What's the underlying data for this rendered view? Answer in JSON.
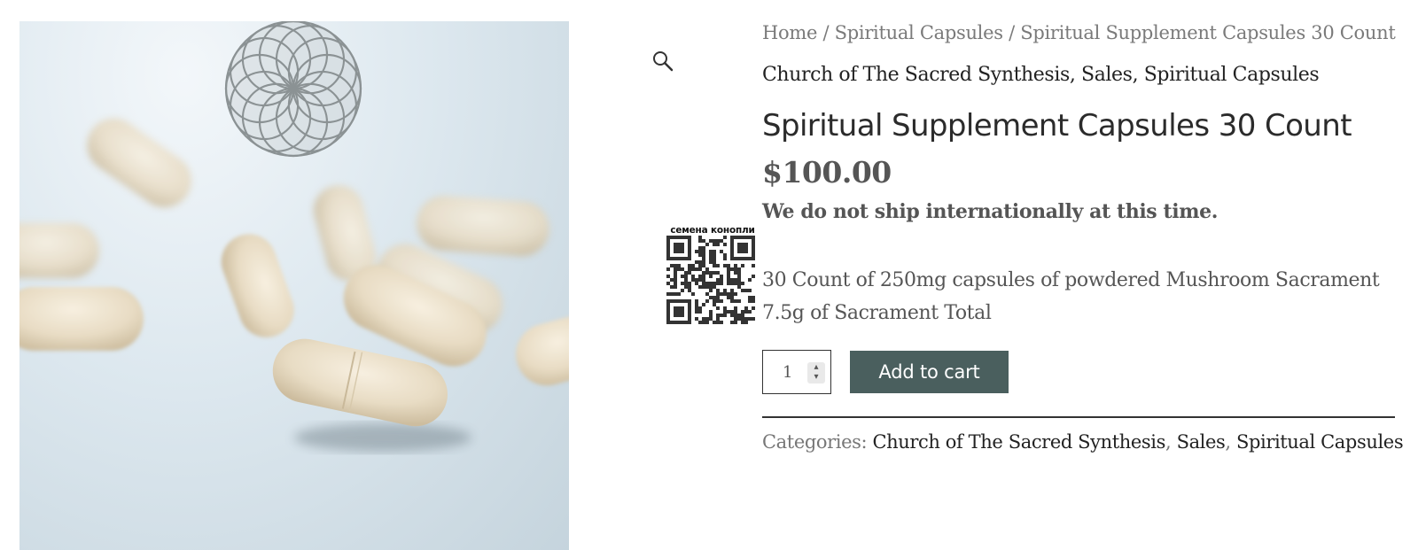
{
  "breadcrumb": {
    "home": "Home",
    "separator": "/",
    "category": "Spiritual Capsules",
    "current": "Spiritual Supplement Capsules 30 Count"
  },
  "product_categories_top": [
    "Church of The Sacred Synthesis",
    "Sales",
    "Spiritual Capsules"
  ],
  "product": {
    "title": "Spiritual Supplement Capsules 30 Count",
    "price": "$100.00",
    "shipping_notice": "We do not ship internationally at this time.",
    "description_lines": [
      "30 Count of 250mg capsules of powdered Mushroom Sacrament",
      "7.5g of Sacrament Total"
    ]
  },
  "cart": {
    "quantity": "1",
    "add_to_cart_label": "Add to cart"
  },
  "meta": {
    "categories_label": "Categories:",
    "categories": [
      "Church of The Sacred Synthesis",
      "Sales",
      "Spiritual Capsules"
    ]
  },
  "qr": {
    "caption": "семена конопли"
  },
  "icons": {
    "zoom": "magnifier-icon"
  },
  "colors": {
    "button_bg": "#4a5f5e",
    "button_text": "#ffffff",
    "logo_gray": "#8b9294",
    "text_muted": "#7a7a7a"
  }
}
